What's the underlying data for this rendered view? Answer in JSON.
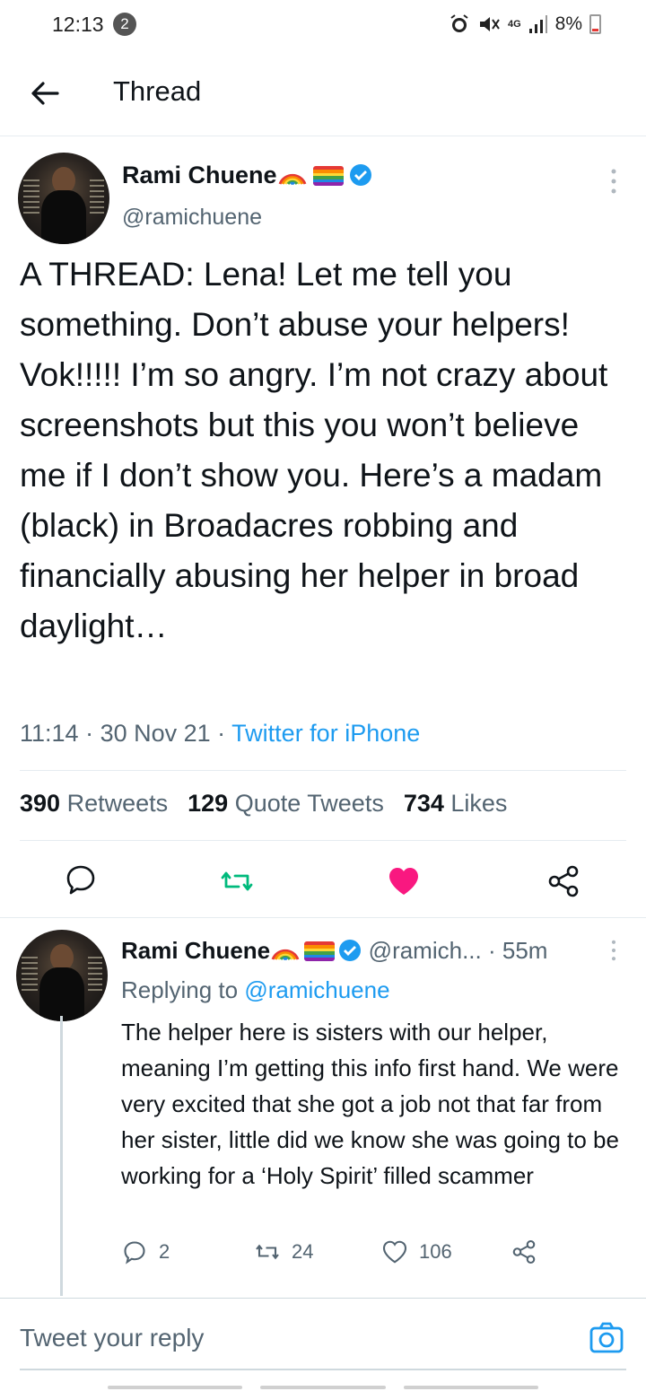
{
  "status_bar": {
    "time": "12:13",
    "notification_count": "2",
    "network": "4G",
    "battery": "8%"
  },
  "topbar": {
    "title": "Thread"
  },
  "main_tweet": {
    "author_name": "Rami Chuene",
    "handle": "@ramichuene",
    "text": "A THREAD: Lena! Let me tell you something. Don’t abuse your helpers! Vok!!!!! I’m so angry. I’m not crazy about screenshots but this you won’t believe me if I don’t show you. Here’s a madam (black) in Broadacres robbing and financially abusing her helper in broad daylight…",
    "time": "11:14",
    "date": "30 Nov 21",
    "source": "Twitter for iPhone",
    "retweets_count": "390",
    "retweets_label": "Retweets",
    "quotes_count": "129",
    "quotes_label": "Quote Tweets",
    "likes_count": "734",
    "likes_label": "Likes"
  },
  "reply_tweet": {
    "author_name": "Rami Chuene",
    "handle_time": "@ramich... · 55m",
    "replying_prefix": "Replying to",
    "replying_to": "@ramichuene",
    "text": "The helper here is sisters with our helper, meaning I’m getting this info first hand. We were very excited that she got a job not that far from her sister, little did we know she was going to be working for a ‘Holy Spirit’ filled scammer",
    "replies": "2",
    "retweets": "24",
    "likes": "106"
  },
  "compose": {
    "placeholder": "Tweet your reply"
  },
  "colors": {
    "accent": "#1d9bf0",
    "retweet": "#00ba7c",
    "like": "#f91880",
    "secondary_text": "#536471"
  }
}
